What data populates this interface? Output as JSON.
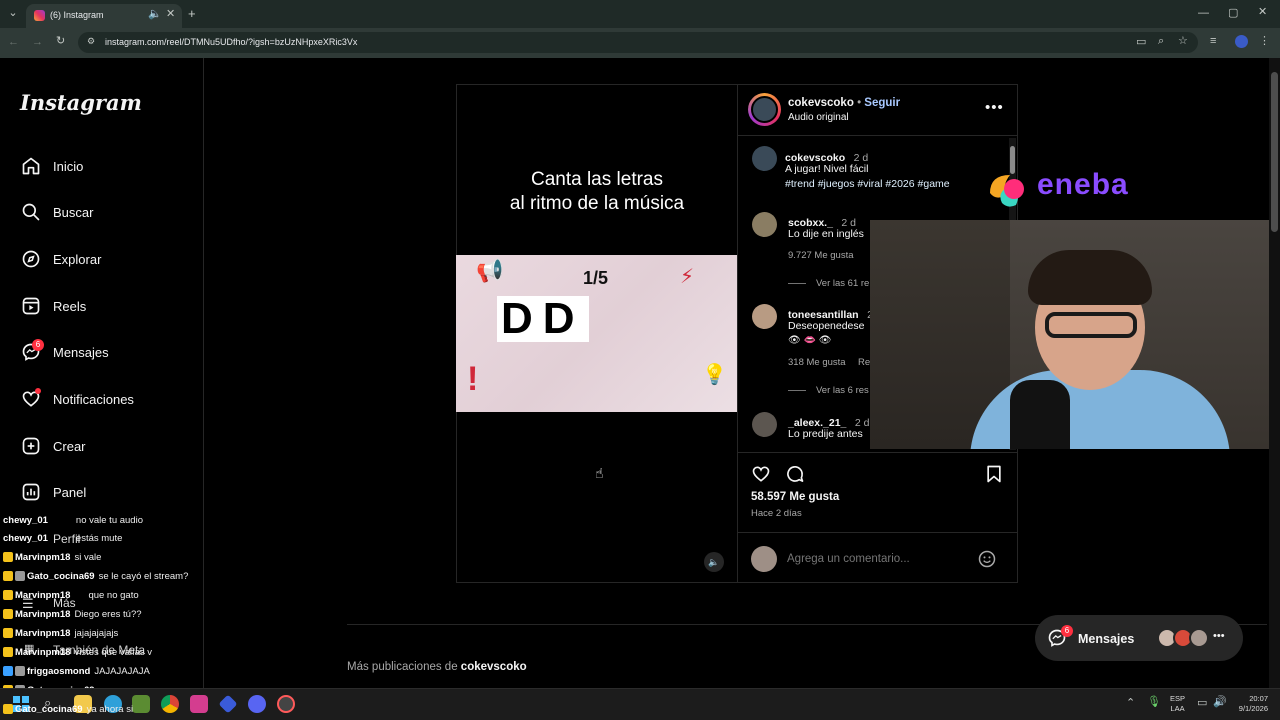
{
  "browser": {
    "tab_title": "(6) Instagram",
    "url": "instagram.com/reel/DTMNu5UDfho/?igsh=bzUzNHpxeXRic3Vx"
  },
  "sidebar": {
    "logo": "Instagram",
    "items": [
      {
        "label": "Inicio",
        "icon": "home-icon"
      },
      {
        "label": "Buscar",
        "icon": "search-icon"
      },
      {
        "label": "Explorar",
        "icon": "compass-icon"
      },
      {
        "label": "Reels",
        "icon": "reels-icon"
      },
      {
        "label": "Mensajes",
        "icon": "messenger-icon",
        "badge": "6"
      },
      {
        "label": "Notificaciones",
        "icon": "heart-icon"
      },
      {
        "label": "Crear",
        "icon": "plus-square-icon"
      },
      {
        "label": "Panel",
        "icon": "chart-icon"
      },
      {
        "label": "Perfil",
        "icon": "avatar"
      },
      {
        "label": "Más",
        "icon": "menu-icon"
      },
      {
        "label": "También de Meta",
        "icon": "grid-icon"
      }
    ]
  },
  "chat": [
    {
      "user": "chewy_01",
      "msg": "no vale tu audio"
    },
    {
      "user": "chewy_01",
      "msg": "estás mute"
    },
    {
      "user": "Marvinpm18",
      "msg": "si vale"
    },
    {
      "user": "Gato_cocina69",
      "msg": "se le cayó el stream?"
    },
    {
      "user": "Marvinpm18",
      "msg": "que no gato"
    },
    {
      "user": "Marvinpm18",
      "msg": "Diego eres tú??"
    },
    {
      "user": "Marvinpm18",
      "msg": "jajajajajajs"
    },
    {
      "user": "Marvinpm18",
      "msg": "vistes que valías v"
    },
    {
      "user": "friggaosmond",
      "msg": "JAJAJAJAJA"
    },
    {
      "user": "Gato_cocina69",
      "msg": ""
    },
    {
      "user": "Gato_cocina69",
      "msg": "ya ahora si"
    }
  ],
  "reel": {
    "caption_line1": "Canta las letras",
    "caption_line2": "al ritmo de la música",
    "counter": "1/5",
    "letters": "DD"
  },
  "post": {
    "author": "cokevscoko",
    "follow": "Seguir",
    "audio": "Audio original",
    "caption_time": "2 d",
    "caption_text": "A jugar! Nivel fácil",
    "caption_tags": "#trend #juegos #viral #2026 #game",
    "comments": [
      {
        "user": "scobxx._",
        "time": "2 d",
        "text": "Lo dije en inglés",
        "likes": "9.727 Me gusta",
        "replies": "Ver las 61 re"
      },
      {
        "user": "toneesantillan",
        "time": "2",
        "text": "Deseopenedese",
        "emoji": "👁 👄 👁",
        "likes": "318 Me gusta",
        "reply_label": "Re",
        "replies": "Ver las 6 res"
      },
      {
        "user": "_aleex._21_",
        "time": "2 d",
        "text": "Lo predije antes"
      }
    ],
    "like_count": "58.597 Me gusta",
    "posted": "Hace 2 días",
    "comment_placeholder": "Agrega un comentario..."
  },
  "footer": {
    "more_prefix": "Más publicaciones de",
    "more_user": "cokevscoko"
  },
  "messages_pill": {
    "label": "Mensajes",
    "badge": "6"
  },
  "sponsor": "eneba",
  "taskbar": {
    "lang1": "ESP",
    "lang2": "LAA",
    "time": "20:07",
    "date": "9/1/2026"
  },
  "colors": {
    "accent_blue": "#0095f6",
    "hashtag": "#e0f1ff",
    "badge_red": "#ff3040",
    "eneba_purple": "#8a4cff"
  }
}
